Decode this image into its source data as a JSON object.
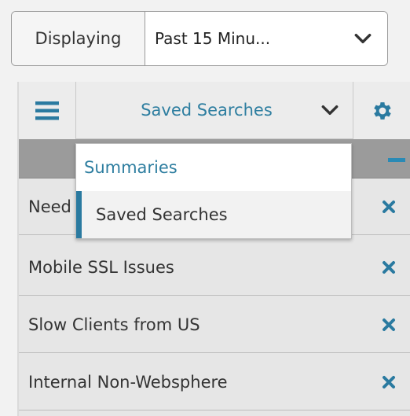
{
  "time_range": {
    "label": "Displaying",
    "selected": "Past 15 Minu..."
  },
  "toolbar": {
    "search_select_label": "Saved Searches"
  },
  "dropdown": {
    "options": [
      "Summaries",
      "Saved Searches"
    ],
    "selected": "Saved Searches"
  },
  "saved_searches": [
    {
      "name": "Need"
    },
    {
      "name": "Mobile SSL Issues"
    },
    {
      "name": "Slow Clients from US"
    },
    {
      "name": "Internal Non-Websphere"
    }
  ],
  "colors": {
    "accent": "#2e7ea0",
    "band": "#9b9b9b",
    "row_bg": "#e6e6e6"
  }
}
